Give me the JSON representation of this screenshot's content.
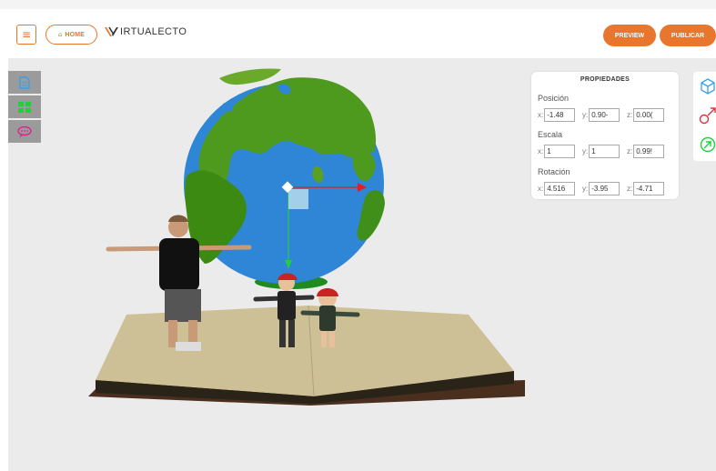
{
  "header": {
    "menu_icon": "hamburger-icon",
    "home_label": "HOME",
    "home_icon": "house-icon",
    "logo_text": "IRTUALECTO",
    "preview_label": "PREVIEW",
    "publish_label": "PUBLICAR"
  },
  "accent_color": "#e8762c",
  "left_tools": [
    {
      "icon": "document-icon",
      "color": "#3aa0e8"
    },
    {
      "icon": "grid-icon",
      "color": "#1fcf3e"
    },
    {
      "icon": "chat-icon",
      "color": "#e0208c"
    }
  ],
  "properties": {
    "title": "PROPIEDADES",
    "position": {
      "label": "Posición",
      "x_label": "x:",
      "y_label": "y:",
      "z_label": "z:",
      "x": "-1.48",
      "y": "0.90-",
      "z": "0.00("
    },
    "scale": {
      "label": "Escala",
      "x_label": "x:",
      "y_label": "y:",
      "z_label": "z:",
      "x": "1",
      "y": "1",
      "z": "0.99!"
    },
    "rotation": {
      "label": "Rotación",
      "x_label": "x:",
      "y_label": "y:",
      "z_label": "z:",
      "x": "4.516",
      "y": "-3.95",
      "z": "-4.71"
    }
  },
  "right_tools": [
    {
      "icon": "move-3d-icon",
      "color": "#3aa0e8"
    },
    {
      "icon": "scale-icon",
      "color": "#e03040"
    },
    {
      "icon": "rotate-icon",
      "color": "#1fcf3e"
    }
  ]
}
